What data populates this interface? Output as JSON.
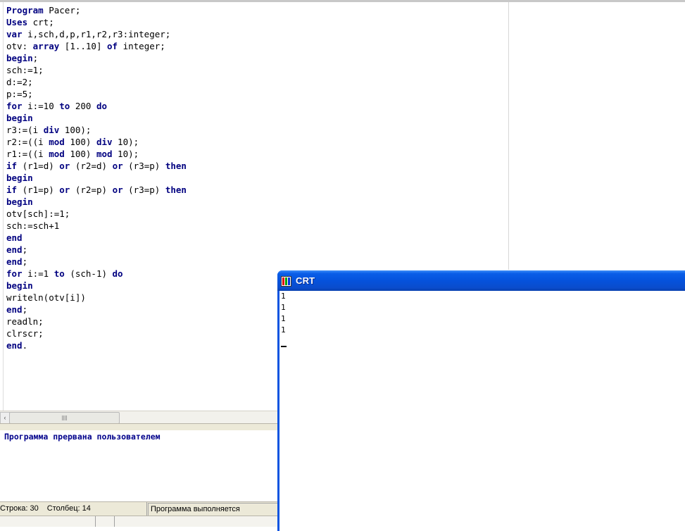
{
  "editor": {
    "code_lines": [
      [
        {
          "t": "Program",
          "kw": true
        },
        {
          "t": " Pacer;"
        }
      ],
      [
        {
          "t": "Uses",
          "kw": true
        },
        {
          "t": " crt;"
        }
      ],
      [
        {
          "t": "var",
          "kw": true
        },
        {
          "t": " i,sch,d,p,r1,r2,r3:integer;"
        }
      ],
      [
        {
          "t": "otv: "
        },
        {
          "t": "array",
          "kw": true
        },
        {
          "t": " [1..10] "
        },
        {
          "t": "of",
          "kw": true
        },
        {
          "t": " integer;"
        }
      ],
      [
        {
          "t": "begin",
          "kw": true
        },
        {
          "t": ";"
        }
      ],
      [
        {
          "t": "sch:=1;"
        }
      ],
      [
        {
          "t": "d:=2;"
        }
      ],
      [
        {
          "t": "p:=5;"
        }
      ],
      [
        {
          "t": "for",
          "kw": true
        },
        {
          "t": " i:=10 "
        },
        {
          "t": "to",
          "kw": true
        },
        {
          "t": " 200 "
        },
        {
          "t": "do",
          "kw": true
        }
      ],
      [
        {
          "t": "begin",
          "kw": true
        }
      ],
      [
        {
          "t": "r3:=(i "
        },
        {
          "t": "div",
          "kw": true
        },
        {
          "t": " 100);"
        }
      ],
      [
        {
          "t": "r2:=((i "
        },
        {
          "t": "mod",
          "kw": true
        },
        {
          "t": " 100) "
        },
        {
          "t": "div",
          "kw": true
        },
        {
          "t": " 10);"
        }
      ],
      [
        {
          "t": "r1:=((i "
        },
        {
          "t": "mod",
          "kw": true
        },
        {
          "t": " 100) "
        },
        {
          "t": "mod",
          "kw": true
        },
        {
          "t": " 10);"
        }
      ],
      [
        {
          "t": "if",
          "kw": true
        },
        {
          "t": " (r1=d) "
        },
        {
          "t": "or",
          "kw": true
        },
        {
          "t": " (r2=d) "
        },
        {
          "t": "or",
          "kw": true
        },
        {
          "t": " (r3=p) "
        },
        {
          "t": "then",
          "kw": true
        }
      ],
      [
        {
          "t": "begin",
          "kw": true
        }
      ],
      [
        {
          "t": "if",
          "kw": true
        },
        {
          "t": " (r1=p) "
        },
        {
          "t": "or",
          "kw": true
        },
        {
          "t": " (r2=p) "
        },
        {
          "t": "or",
          "kw": true
        },
        {
          "t": " (r3=p) "
        },
        {
          "t": "then",
          "kw": true
        }
      ],
      [
        {
          "t": "begin",
          "kw": true
        }
      ],
      [
        {
          "t": "otv[sch]:=1;"
        }
      ],
      [
        {
          "t": "sch:=sch+1"
        }
      ],
      [
        {
          "t": "end",
          "kw": true
        }
      ],
      [
        {
          "t": "end",
          "kw": true
        },
        {
          "t": ";"
        }
      ],
      [
        {
          "t": "end",
          "kw": true
        },
        {
          "t": ";"
        }
      ],
      [
        {
          "t": "for",
          "kw": true
        },
        {
          "t": " i:=1 "
        },
        {
          "t": "to",
          "kw": true
        },
        {
          "t": " (sch-1) "
        },
        {
          "t": "do",
          "kw": true
        }
      ],
      [
        {
          "t": "begin",
          "kw": true
        }
      ],
      [
        {
          "t": "writeln(otv[i])"
        }
      ],
      [
        {
          "t": "end",
          "kw": true
        },
        {
          "t": ";"
        }
      ],
      [
        {
          "t": "readln;"
        }
      ],
      [
        {
          "t": "clrscr;"
        }
      ],
      [
        {
          "t": "end",
          "kw": true
        },
        {
          "t": "."
        }
      ]
    ]
  },
  "scrollbar": {
    "left_arrow": "‹",
    "grip": "|||"
  },
  "output_pane": {
    "message": "Программа прервана пользователем"
  },
  "statusbar": {
    "line_label": "Строка: 30",
    "column_label": "Столбец: 14",
    "state": "Программа выполняется"
  },
  "crt_window": {
    "title": "CRT",
    "output_lines": [
      "1",
      "1",
      "1",
      "1"
    ]
  }
}
